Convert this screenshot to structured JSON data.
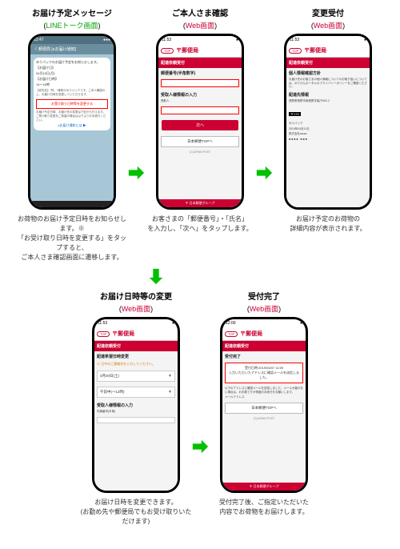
{
  "row1": {
    "step1": {
      "title": "お届け予定メッセージ",
      "subtitle_prefix": "(",
      "subtitle_green": "LINEトーク画面",
      "subtitle_suffix": ")",
      "time": "12:47",
      "header": "郵便局 [eお届け通知]",
      "bubble_lines": [
        "ゆうパックのお届け予定をお知らせします。",
        "【お届け日】",
        "04月15日(月)",
        "【お届け日時】",
        "14～16時"
      ],
      "bubble_text1": "【宛先名】*样、*様宛のゆうパックです。ご本人確認の上、お届け日時を変更していただけます。",
      "cta": "お受け取り日時等を変更する",
      "bubble_text2": "お届け予定日時、お届け先の変更は下記から行えます。ご受け取り変更をご希望の場合は以下よりお手続きください。",
      "bottom_text": "eお届け通知とは ▶",
      "caption": "お荷物のお届け予定日時をお知らせします。※\n「お受け取り日時を変更する」をタップすると、\nご本人さま確認画面に遷移します。"
    },
    "step2": {
      "title": "ご本人さま確認",
      "subtitle_prefix": "(",
      "subtitle_red": "Web画面",
      "subtitle_suffix": ")",
      "time": "11:53",
      "top": "TOP",
      "brand": "郵便局",
      "redbar": "配達依頼受付",
      "field1_label": "郵便番号(半角数字)",
      "section": "受取人様情報の入力",
      "field2_label": "受取人",
      "next": "次へ",
      "back": "日本郵便TOPへ",
      "copyright": "(C)JAPAN POST",
      "footer": "日本郵便グループ",
      "caption": "お客さまの「郵便番号」・「氏名」\nを入力し、「次へ」をタップします。"
    },
    "step3": {
      "title": "変更受付",
      "subtitle_prefix": "(",
      "subtitle_red": "Web画面",
      "subtitle_suffix": ")",
      "time": "11:53",
      "top": "TOP",
      "brand": "郵便局",
      "redbar": "配達依頼受付",
      "section": "個人情報確認方針",
      "text1": "お届け先のお客さまの個人情報についてのお取り扱いについては、ゆうびんポータルのプライバシーポリシーをご確認ください。",
      "section2": "配達先情報",
      "line1": "長野県長野市南長野字幅下692-2",
      "line2": "〒179",
      "type": "ゆうパック",
      "date": "2019年04月11日",
      "company": "株式会社●●●●",
      "barcode": "■■■■ ■■■",
      "caption": "お届け予定のお荷物の\n詳細内容が表示されます。"
    }
  },
  "row2": {
    "step4": {
      "title": "お届け日時等の変更",
      "subtitle_prefix": "(",
      "subtitle_red": "Web画面",
      "subtitle_suffix": ")",
      "time": "11:53",
      "top": "TOP",
      "brand": "郵便局",
      "redbar": "配達依頼受付",
      "section": "配達希望日時変更",
      "note": "※ 日中のご連絡先を入力してください。",
      "date_field": "4月20日(土)",
      "time_field": "午前中(～12時)",
      "section2": "受取人様情報の入力",
      "label1": "内線番号(半角)",
      "caption": "お届け日時を変更できます。\n(お勤め先や郵便局でもお受け取りいただけます)"
    },
    "step5": {
      "title": "受付完了",
      "subtitle_prefix": "(",
      "subtitle_red": "Web画面",
      "subtitle_suffix": ")",
      "time": "12:00",
      "top": "TOP",
      "brand": "郵便局",
      "redbar": "配達依頼受付",
      "section": "受付完了",
      "done_box": "受付日時:2019/04/07 11:59\n入力いただいたアドレスに確認メールを送信しました。",
      "note_text": "以下のアドレスに確認メールを送信しました。メールが届かない場合は、お手数ですが再度お手続きをお願いします。",
      "mail_label": "メールアドレス",
      "back": "日本郵便TOPへ",
      "copyright": "(C)JAPAN POST",
      "footer": "日本郵便グループ",
      "caption": "受付完了後、ご指定いただいた\n内容でお荷物をお届けします。"
    }
  }
}
